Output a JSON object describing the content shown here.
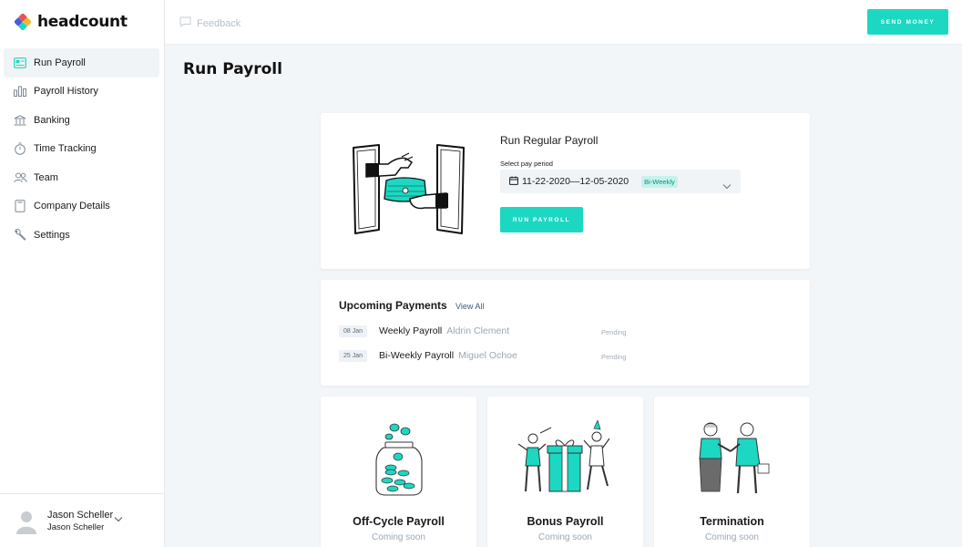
{
  "app": {
    "name": "headcount",
    "brand_colors": [
      "#1cd8c2",
      "#e8524a",
      "#f5b72b",
      "#4b5ad9"
    ]
  },
  "sidebar": {
    "items": [
      {
        "label": "Run Payroll",
        "icon": "payroll-card-icon",
        "active": true
      },
      {
        "label": "Payroll History",
        "icon": "bar-chart-icon",
        "active": false
      },
      {
        "label": "Banking",
        "icon": "bank-icon",
        "active": false
      },
      {
        "label": "Time Tracking",
        "icon": "stopwatch-icon",
        "active": false
      },
      {
        "label": "Team",
        "icon": "team-icon",
        "active": false
      },
      {
        "label": "Company Details",
        "icon": "document-icon",
        "active": false
      },
      {
        "label": "Settings",
        "icon": "wrench-icon",
        "active": false
      }
    ],
    "user": {
      "name": "Jason Scheller",
      "subtitle": "Jason Scheller"
    }
  },
  "topbar": {
    "feedback_label": "Feedback",
    "send_money_label": "SEND MONEY"
  },
  "page": {
    "title": "Run Payroll"
  },
  "run_payroll": {
    "title": "Run Regular Payroll",
    "pay_period_label": "Select pay period",
    "pay_period_value": "11-22-2020—12-05-2020",
    "frequency_badge": "Bi-Weekly",
    "button_label": "RUN PAYROLL"
  },
  "upcoming": {
    "title": "Upcoming Payments",
    "view_all": "View All",
    "payments": [
      {
        "date": "08 Jan",
        "type": "Weekly Payroll",
        "person": "Aldrin Clement",
        "status": "Pending"
      },
      {
        "date": "25 Jan",
        "type": "Bi-Weekly Payroll",
        "person": "Miguel Ochoe",
        "status": "Pending"
      }
    ]
  },
  "tiles": [
    {
      "title": "Off-Cycle Payroll",
      "subtitle": "Coming soon",
      "icon": "coin-jar-illustration"
    },
    {
      "title": "Bonus Payroll",
      "subtitle": "Coming soon",
      "icon": "gift-celebration-illustration"
    },
    {
      "title": "Termination",
      "subtitle": "Coming soon",
      "icon": "handshake-illustration"
    }
  ],
  "colors": {
    "accent": "#1cd8c2",
    "muted_text": "#9aa8b7",
    "background": "#f3f6f9"
  }
}
